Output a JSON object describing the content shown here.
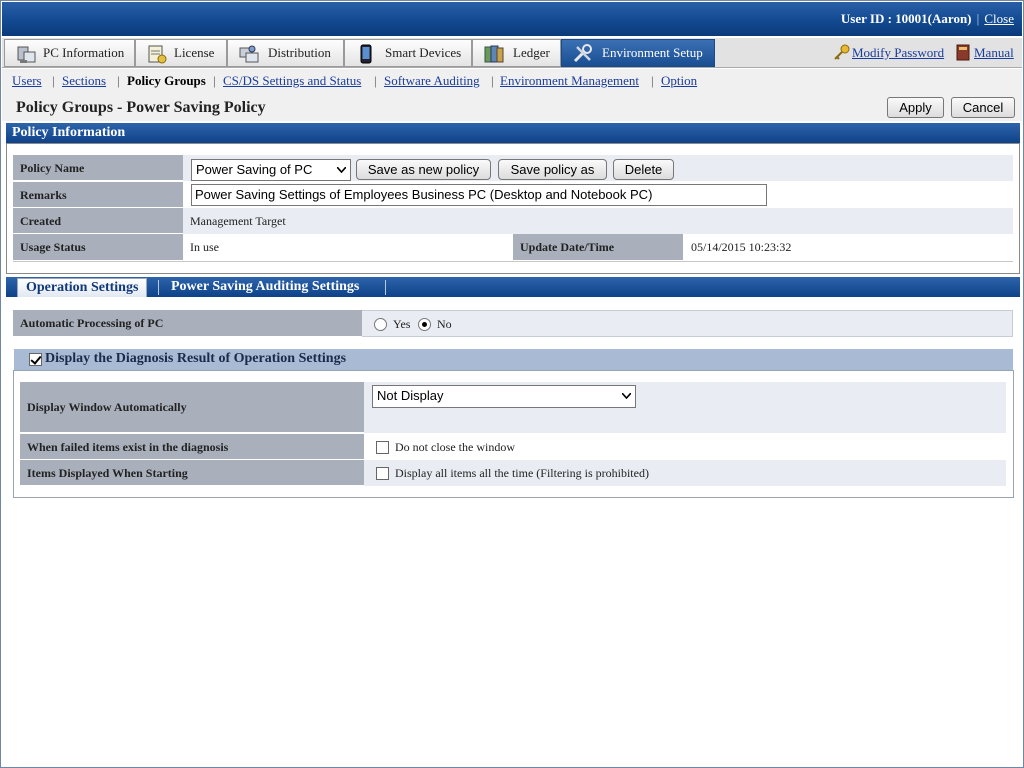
{
  "header": {
    "user_label": "User ID : 10001(Aaron)",
    "close_link": "Close"
  },
  "main_tabs": [
    {
      "label": "PC Information",
      "icon": "pc-information-icon"
    },
    {
      "label": "License",
      "icon": "license-icon"
    },
    {
      "label": "Distribution",
      "icon": "distribution-icon"
    },
    {
      "label": "Smart Devices",
      "icon": "smart-devices-icon"
    },
    {
      "label": "Ledger",
      "icon": "ledger-icon"
    },
    {
      "label": "Environment Setup",
      "icon": "environment-setup-icon",
      "active": true
    }
  ],
  "right_links": {
    "modify_password": "Modify Password",
    "manual": "Manual"
  },
  "subnav": {
    "users": "Users",
    "sections": "Sections",
    "policy_groups": "Policy Groups",
    "csds": "CS/DS Settings and Status",
    "software_auditing": "Software Auditing",
    "environment_management": "Environment Management",
    "option": "Option",
    "separator": "|"
  },
  "page": {
    "title": "Policy Groups - Power Saving Policy",
    "apply": "Apply",
    "cancel": "Cancel"
  },
  "policy_info": {
    "section_title": "Policy Information",
    "policy_name_label": "Policy Name",
    "policy_name_value": "Power Saving of PC",
    "save_new": "Save as new policy",
    "save_as": "Save policy as",
    "delete": "Delete",
    "remarks_label": "Remarks",
    "remarks_value": "Power Saving Settings of Employees Business PC (Desktop and Notebook PC)",
    "created_label": "Created",
    "created_value": "Management Target",
    "usage_label": "Usage Status",
    "usage_value": "In use",
    "update_label": "Update Date/Time",
    "update_value": "05/14/2015 10:23:32"
  },
  "settings_tabs": {
    "operation": "Operation Settings",
    "auditing": "Power Saving Auditing Settings"
  },
  "operation": {
    "auto_label": "Automatic Processing of PC",
    "yes": "Yes",
    "no": "No",
    "selected": "No",
    "diag_title": "Display the Diagnosis Result of Operation Settings",
    "diag_checked": true,
    "display_window_label": "Display Window Automatically",
    "display_window_value": "Not Display",
    "failed_label": "When failed items exist in the diagnosis",
    "failed_option": "Do not close the window",
    "failed_checked": false,
    "items_label": "Items Displayed When Starting",
    "items_option": "Display all items all the time (Filtering is prohibited)",
    "items_checked": false
  }
}
